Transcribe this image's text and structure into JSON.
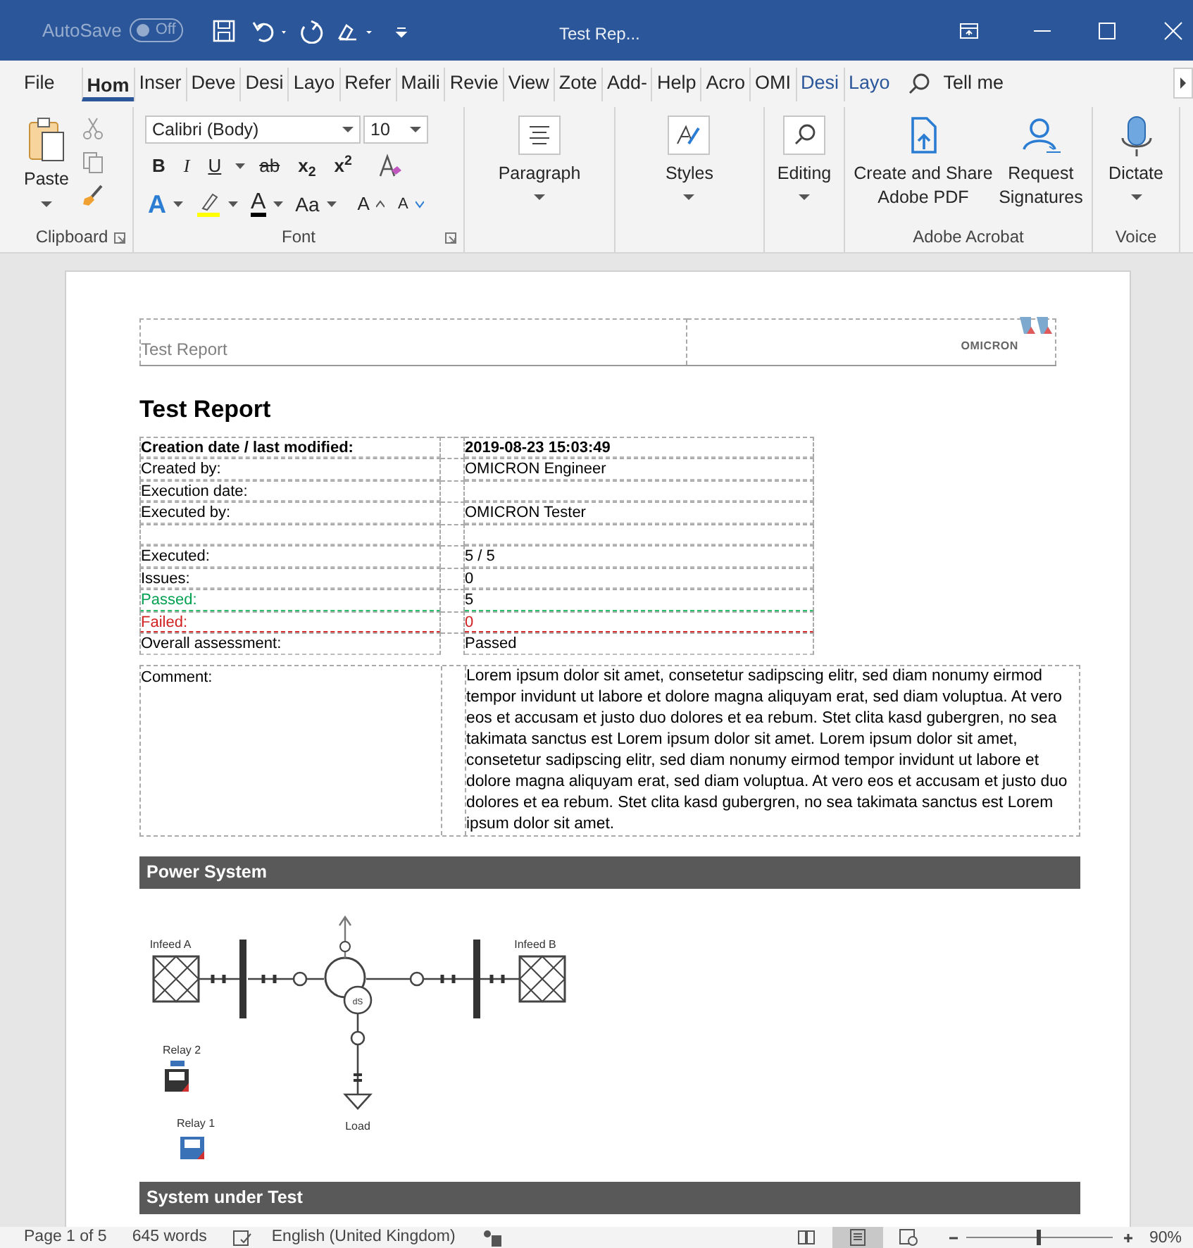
{
  "title_bar": {
    "autosave_label": "AutoSave",
    "autosave_toggle": {
      "label": "Off",
      "on": false
    },
    "title": "Test Rep..."
  },
  "tabs": [
    {
      "label": "File",
      "selected": false,
      "kind": "normal"
    },
    {
      "label": "Hom",
      "selected": true,
      "kind": "normal"
    },
    {
      "label": "Inser",
      "selected": false,
      "kind": "normal"
    },
    {
      "label": "Deve",
      "selected": false,
      "kind": "normal"
    },
    {
      "label": "Desi",
      "selected": false,
      "kind": "normal"
    },
    {
      "label": "Layo",
      "selected": false,
      "kind": "normal"
    },
    {
      "label": "Refer",
      "selected": false,
      "kind": "normal"
    },
    {
      "label": "Maili",
      "selected": false,
      "kind": "normal"
    },
    {
      "label": "Revie",
      "selected": false,
      "kind": "normal"
    },
    {
      "label": "View",
      "selected": false,
      "kind": "normal"
    },
    {
      "label": "Zote",
      "selected": false,
      "kind": "normal"
    },
    {
      "label": "Add-",
      "selected": false,
      "kind": "normal"
    },
    {
      "label": "Help",
      "selected": false,
      "kind": "normal"
    },
    {
      "label": "Acro",
      "selected": false,
      "kind": "normal"
    },
    {
      "label": "OMI",
      "selected": false,
      "kind": "normal"
    },
    {
      "label": "Desi",
      "selected": false,
      "kind": "contextual"
    },
    {
      "label": "Layo",
      "selected": false,
      "kind": "contextual"
    }
  ],
  "tell_me": "Tell me",
  "ribbon": {
    "paste": "Paste",
    "font_name": "Calibri (Body)",
    "font_size": "10",
    "font_buttons": [
      "B",
      "I",
      "U",
      "ab",
      "x$_{2}$",
      "x$^{2}$"
    ],
    "font_row2": [
      "A",
      "A",
      "Aa",
      "A",
      "A"
    ],
    "paragraph": "Paragraph",
    "styles": "Styles",
    "editing": "Editing",
    "acrobat_buttons": [
      "Create and Share\nAdobe PDF",
      "Request\nSignatures"
    ],
    "dictate": "Dictate",
    "groups": [
      "Clipboard",
      "Font",
      "Adobe Acrobat",
      "Voice"
    ]
  },
  "document": {
    "header_text": "Test Report",
    "logo_text": "OMICRON",
    "heading": "Test Report",
    "info_rows": [
      {
        "label": "Creation date / last modified:",
        "value": "2019-08-23 15:03:49",
        "kind": "bold"
      },
      {
        "label": "Created by:",
        "value": "OMICRON Engineer",
        "kind": "normal"
      },
      {
        "label": "Execution date:",
        "kind": "normal"
      },
      {
        "label": "Executed by:",
        "value": "OMICRON Tester",
        "kind": "normal"
      },
      {
        "kind": "spacer"
      },
      {
        "label": "Executed:",
        "value": "5 / 5",
        "kind": "normal"
      },
      {
        "label": "Issues:",
        "value": "0",
        "kind": "normal"
      },
      {
        "label": "Passed:",
        "value": "5",
        "kind": "passed"
      },
      {
        "label": "Failed:",
        "value": "0",
        "kind": "failed"
      },
      {
        "label": "Overall assessment:",
        "value": "Passed",
        "kind": "normal"
      }
    ],
    "comment": {
      "label": "Comment:",
      "text": "Lorem ipsum dolor sit amet, consetetur sadipscing elitr, sed diam nonumy eirmod tempor invidunt ut labore et dolore magna aliquyam erat, sed diam voluptua. At vero eos et accusam et justo duo dolores et ea rebum. Stet clita kasd gubergren, no sea takimata sanctus est Lorem ipsum dolor sit amet. Lorem ipsum dolor sit amet, consetetur sadipscing elitr, sed diam nonumy eirmod tempor invidunt ut labore et dolore magna aliquyam erat, sed diam voluptua. At vero eos et accusam et justo duo dolores et ea rebum. Stet clita kasd gubergren, no sea takimata sanctus est Lorem ipsum dolor sit amet."
    },
    "sections": [
      "Power System",
      "System under Test"
    ],
    "diagram": {
      "infeed_a": "Infeed A",
      "infeed_b": "Infeed B",
      "transformer": "dS",
      "relay_2": "Relay 2",
      "relay_1": "Relay 1",
      "load": "Load"
    }
  },
  "status_bar": {
    "page": "Page 1 of 5",
    "words": "645 words",
    "language": "English (United Kingdom)",
    "views": [
      {
        "kind": "read",
        "selected": false
      },
      {
        "kind": "print",
        "selected": true
      },
      {
        "kind": "web",
        "selected": false
      }
    ],
    "zoom": {
      "level": 0.48,
      "reading": "90%"
    }
  }
}
